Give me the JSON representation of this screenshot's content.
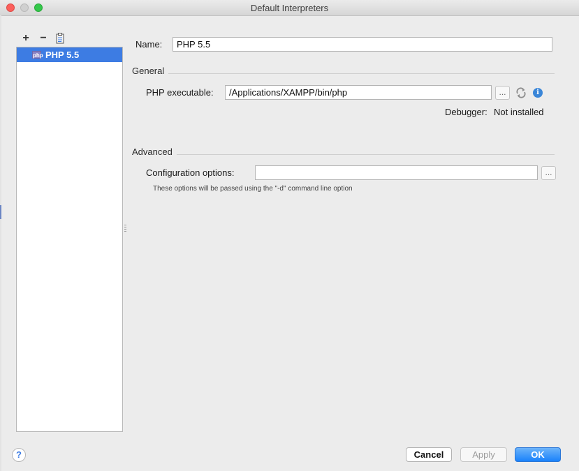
{
  "window": {
    "title": "Default Interpreters"
  },
  "toolbar": {
    "add_label": "+",
    "remove_label": "−",
    "copy_icon": "copy-icon"
  },
  "interpreters": [
    {
      "label": "PHP 5.5",
      "icon_text": "php"
    }
  ],
  "name": {
    "label": "Name:",
    "value": "PHP 5.5"
  },
  "general": {
    "title": "General",
    "executable_label": "PHP executable:",
    "executable_value": "/Applications/XAMPP/bin/php",
    "browse_label": "...",
    "debugger_label": "Debugger:",
    "debugger_value": "Not installed"
  },
  "advanced": {
    "title": "Advanced",
    "config_label": "Configuration options:",
    "config_value": "",
    "browse_label": "...",
    "hint": "These options will be passed using the \"-d\" command line option"
  },
  "footer": {
    "help_label": "?",
    "cancel_label": "Cancel",
    "apply_label": "Apply",
    "ok_label": "OK"
  },
  "colors": {
    "selection": "#3d7ce3",
    "primary_button": "#1a82fb"
  }
}
